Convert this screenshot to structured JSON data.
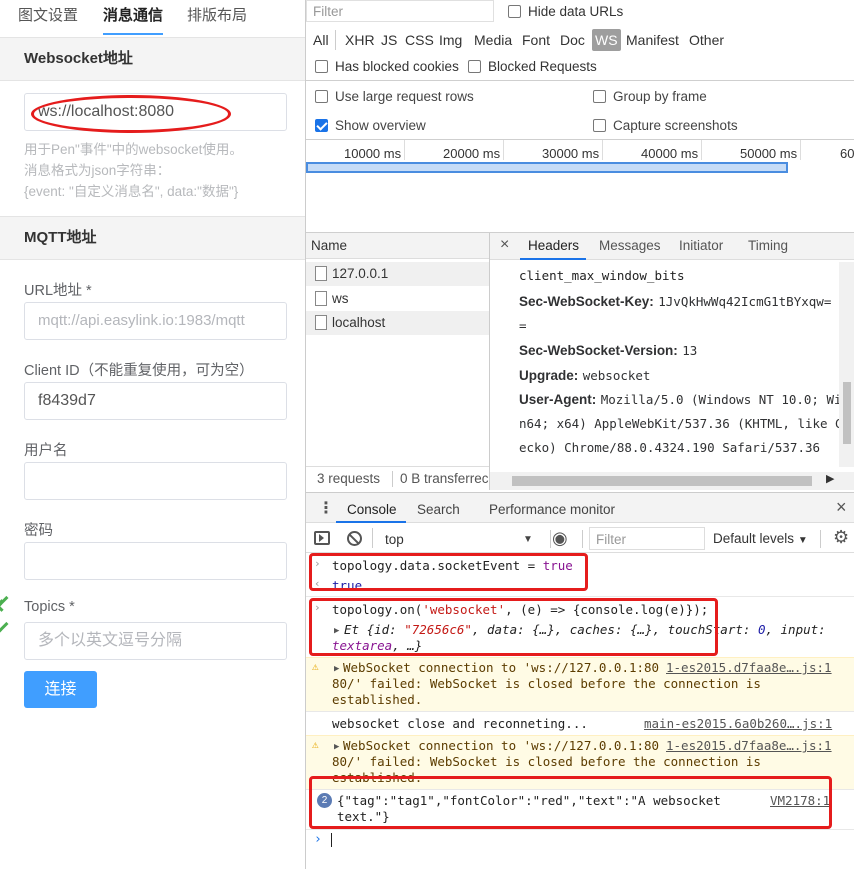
{
  "left": {
    "tabs": [
      "图文设置",
      "消息通信",
      "排版布局"
    ],
    "websocket_section": "Websocket地址",
    "websocket_value": "ws://localhost:8080",
    "websocket_hint": [
      "用于Pen\"事件\"中的websocket使用。",
      "消息格式为json字符串：",
      "{event: \"自定义消息名\", data:\"数据\"}"
    ],
    "mqtt_section": "MQTT地址",
    "url_label": "URL地址 *",
    "url_placeholder": "mqtt://api.easylink.io:1983/mqtt",
    "clientid_label": "Client ID（不能重复使用，可为空）",
    "clientid_value": "f8439d7",
    "username_label": "用户名",
    "password_label": "密码",
    "topics_label": "Topics *",
    "topics_placeholder": "多个以英文逗号分隔",
    "connect_button": "连接"
  },
  "devtools": {
    "filter_placeholder": "Filter",
    "hide_data_urls": "Hide data URLs",
    "types": [
      "All",
      "XHR",
      "JS",
      "CSS",
      "Img",
      "Media",
      "Font",
      "Doc",
      "WS",
      "Manifest",
      "Other"
    ],
    "has_blocked_cookies": "Has blocked cookies",
    "blocked_requests": "Blocked Requests",
    "use_large_rows": "Use large request rows",
    "group_by_frame": "Group by frame",
    "show_overview": "Show overview",
    "capture_screenshots": "Capture screenshots",
    "timeline_ticks": [
      "10000 ms",
      "20000 ms",
      "30000 ms",
      "40000 ms",
      "50000 ms",
      "60"
    ],
    "name_col": "Name",
    "requests": [
      "127.0.0.1",
      "ws",
      "localhost"
    ],
    "detail_tabs": [
      "Headers",
      "Messages",
      "Initiator",
      "Timing"
    ],
    "headers": {
      "line0": "client_max_window_bits",
      "key_label": "Sec-WebSocket-Key:",
      "key_value": "1JvQkHwWq42IcmG1tBYxqw=",
      "key_cont": "=",
      "ver_label": "Sec-WebSocket-Version:",
      "ver_value": "13",
      "upgrade_label": "Upgrade:",
      "upgrade_value": "websocket",
      "ua_label": "User-Agent:",
      "ua_1": "Mozilla/5.0 (Windows NT 10.0; Wi",
      "ua_2": "n64; x64) AppleWebKit/537.36 (KHTML, like G",
      "ua_3": "ecko) Chrome/88.0.4324.190 Safari/537.36"
    },
    "status_requests": "3 requests",
    "status_transferred": "0 B transferrec",
    "drawer_tabs": [
      "Console",
      "Search",
      "Performance monitor"
    ],
    "context": "top",
    "console_filter": "Filter",
    "levels": "Default levels",
    "console": {
      "cmd1_a": "topology.data.socketEvent = ",
      "cmd1_b": "true",
      "res1": "true",
      "cmd2_a": "topology.on(",
      "cmd2_b": "'websocket'",
      "cmd2_c": ", (e) => {console.log(e)});",
      "obj_1a": "Et {id: ",
      "obj_1b": "\"72656c6\"",
      "obj_1c": ", data: {…}, caches: {…}, touchStart: ",
      "obj_1d": "0",
      "obj_1e": ", input:",
      "obj_2a": "textarea",
      "obj_2b": ", …}",
      "warn_a1": "WebSocket connection to 'ws://127.0.0.1:80",
      "warn_a_src": "1-es2015.d7faa8e….js:1",
      "warn_a2": "80/' failed: WebSocket is closed before the connection is",
      "warn_a3": "established.",
      "log1": "websocket close and reconneting...",
      "log1_src": "main-es2015.6a0b260….js:1",
      "warn_b1": "WebSocket connection to 'ws://127.0.0.1:80",
      "warn_b_src": "1-es2015.d7faa8e….js:1",
      "warn_b2": "80/' failed: WebSocket is closed before the connection is",
      "warn_b3": "established.",
      "count": "2",
      "msg1": "{\"tag\":\"tag1\",\"fontColor\":\"red\",\"text\":\"A websocket",
      "msg2": "text.\"}",
      "msg_src": "VM2178:1"
    }
  }
}
